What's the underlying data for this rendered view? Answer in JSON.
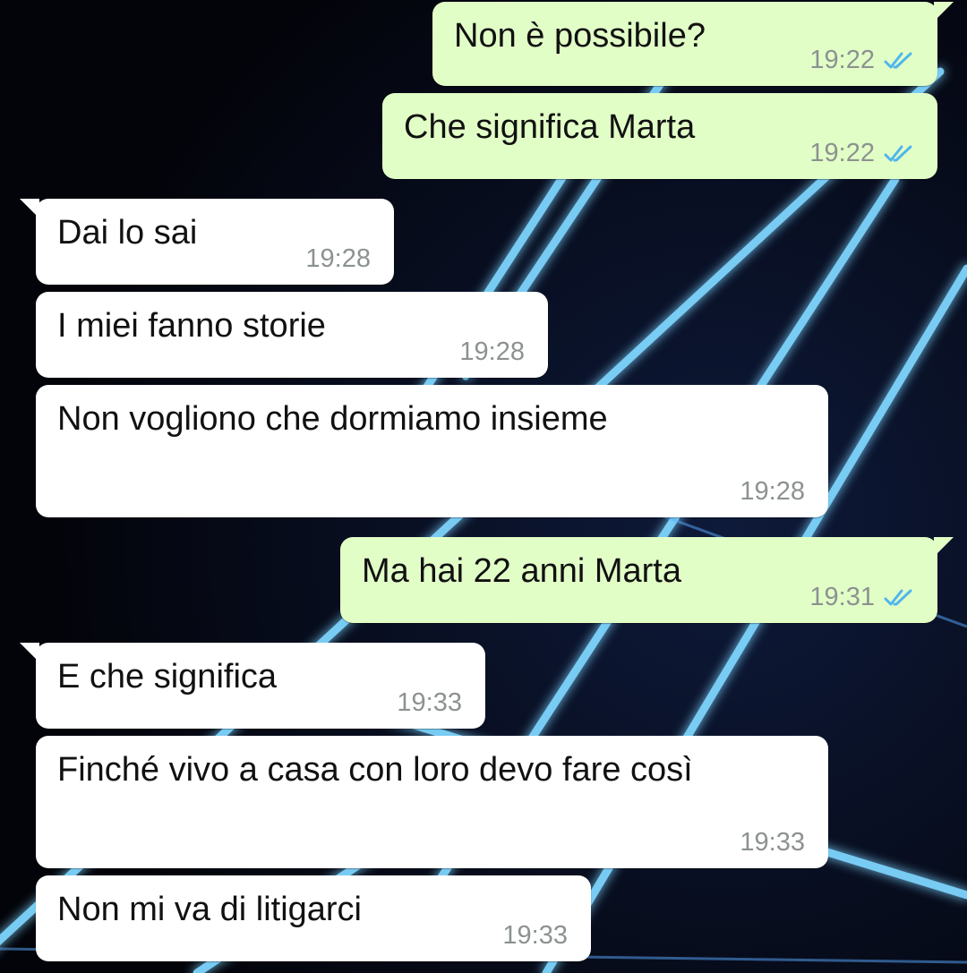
{
  "chat": {
    "messages": [
      {
        "id": "m1",
        "direction": "out",
        "text": "Non è possibile?",
        "time": "19:22",
        "status": "read"
      },
      {
        "id": "m2",
        "direction": "out",
        "text": "Che significa Marta",
        "time": "19:22",
        "status": "read"
      },
      {
        "id": "m3",
        "direction": "in",
        "text": "Dai lo sai",
        "time": "19:28"
      },
      {
        "id": "m4",
        "direction": "in",
        "text": "I miei fanno storie",
        "time": "19:28"
      },
      {
        "id": "m5",
        "direction": "in",
        "text": "Non vogliono che dormiamo insieme",
        "time": "19:28"
      },
      {
        "id": "m6",
        "direction": "out",
        "text": "Ma hai 22 anni Marta",
        "time": "19:31",
        "status": "read"
      },
      {
        "id": "m7",
        "direction": "in",
        "text": "E che significa",
        "time": "19:33"
      },
      {
        "id": "m8",
        "direction": "in",
        "text": "Finché vivo a casa con loro devo fare così",
        "time": "19:33"
      },
      {
        "id": "m9",
        "direction": "in",
        "text": "Non mi va di litigarci",
        "time": "19:33"
      }
    ]
  },
  "colors": {
    "outgoing_bubble": "#e2fec7",
    "incoming_bubble": "#ffffff",
    "read_ticks": "#4fb6ec",
    "timestamp": "#8c9290",
    "wallpaper_dark": "#05060d",
    "wallpaper_neon": "#7fd6ff"
  },
  "icons": {
    "read_status": "double-check-icon"
  }
}
